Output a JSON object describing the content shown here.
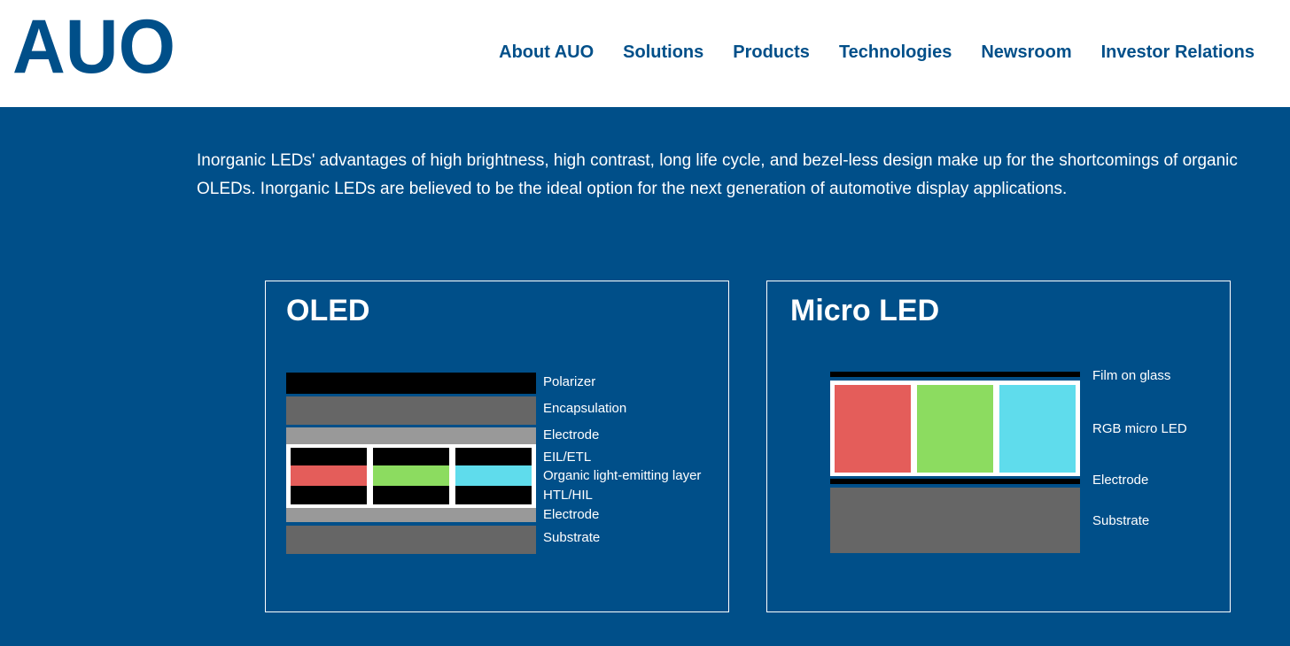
{
  "header": {
    "logo_text": "AUO",
    "nav": [
      "About AUO",
      "Solutions",
      "Products",
      "Technologies",
      "Newsroom",
      "Investor Relations"
    ]
  },
  "intro": {
    "text": "Inorganic LEDs' advantages of high brightness, high contrast, long life cycle, and bezel-less design make up for the shortcomings of organic OLEDs. Inorganic LEDs are believed to be the ideal option for the next generation of automotive display applications."
  },
  "oled": {
    "title": "OLED",
    "layers": [
      "Polarizer",
      "Encapsulation",
      "Electrode",
      "EIL/ETL",
      "Organic light-emitting layer",
      "HTL/HIL",
      "Electrode",
      "Substrate"
    ]
  },
  "microled": {
    "title": "Micro LED",
    "layers": [
      "Film on glass",
      "RGB micro LED",
      "Electrode",
      "Substrate"
    ]
  },
  "colors": {
    "brand_blue": "#004f89",
    "red": "#e45d5a",
    "green": "#8cdc60",
    "cyan": "#5fdcec",
    "dark_gray": "#666666",
    "light_gray": "#999999"
  }
}
